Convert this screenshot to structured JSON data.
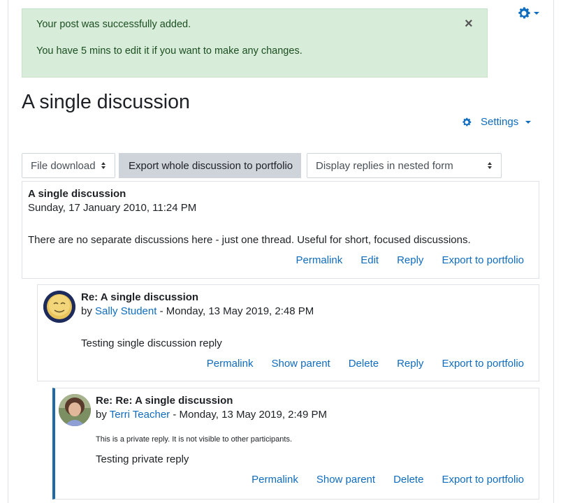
{
  "alert": {
    "line1": "Your post was successfully added.",
    "line2": "You have 5 mins to edit it if you want to make any changes.",
    "close": "×"
  },
  "page": {
    "title": "A single discussion",
    "settings_label": "Settings"
  },
  "controls": {
    "download_select": "File download",
    "export_button": "Export whole discussion to portfolio",
    "display_select": "Display replies in nested form"
  },
  "posts": [
    {
      "subject": "A single discussion",
      "date": "Sunday, 17 January 2010, 11:24 PM",
      "body": "There are no separate discussions here - just one thread. Useful for short, focused discussions.",
      "actions": [
        "Permalink",
        "Edit",
        "Reply",
        "Export to portfolio"
      ]
    },
    {
      "subject": "Re: A single discussion",
      "by": "by ",
      "author": "Sally Student",
      "date": " - Monday, 13 May 2019, 2:48 PM",
      "body": "Testing single discussion reply",
      "actions": [
        "Permalink",
        "Show parent",
        "Delete",
        "Reply",
        "Export to portfolio"
      ]
    },
    {
      "subject": "Re: Re: A single discussion",
      "by": "by ",
      "author": "Terri Teacher",
      "date": " - Monday, 13 May 2019, 2:49 PM",
      "private_note": "This is a private reply. It is not visible to other participants.",
      "body": "Testing private reply",
      "actions": [
        "Permalink",
        "Show parent",
        "Delete",
        "Export to portfolio"
      ]
    }
  ],
  "icons": {
    "gear": "gear-icon",
    "settings_gear": "gear-icon",
    "close": "close-icon"
  },
  "colors": {
    "link": "#0f6cbf",
    "alert_bg": "#d7ecd9",
    "alert_text": "#1c4f21",
    "private_bar": "#1f69a8"
  }
}
